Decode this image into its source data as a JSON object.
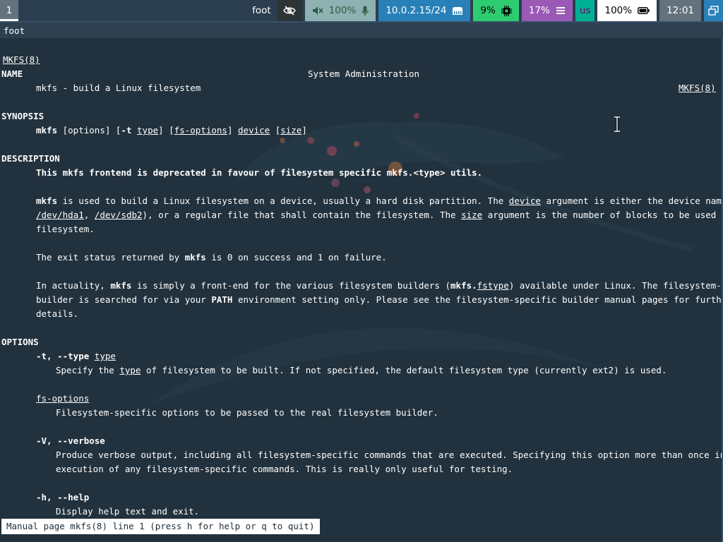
{
  "topbar": {
    "workspace": "1",
    "window_title": "foot",
    "idle_icon": "eye-slash-icon",
    "audio": {
      "volume": "100%",
      "muted_icon": "speaker-muted-icon",
      "mic_icon": "microphone-icon"
    },
    "network": {
      "address": "10.0.2.15/24",
      "icon": "ethernet-icon"
    },
    "cpu": {
      "value": "9%",
      "icon": "cpu-chip-icon"
    },
    "memory": {
      "value": "17%",
      "icon": "memory-icon"
    },
    "language": "us",
    "battery": {
      "value": "100%",
      "icon": "battery-full-icon"
    },
    "clock": "12:01",
    "tray_icon": "window-switcher-icon"
  },
  "window": {
    "title": "foot"
  },
  "man": {
    "header_left": "MKFS(8)",
    "header_center": "System Administration",
    "header_right": "MKFS(8)",
    "name_heading": "NAME",
    "name_text": "mkfs - build a Linux filesystem",
    "synopsis_heading": "SYNOPSIS",
    "synopsis": {
      "cmd": "mkfs",
      "a": " [options] [",
      "t_opt": "-t",
      "b": " ",
      "type": "type",
      "c": "] [",
      "fsopts": "fs-options",
      "d": "] ",
      "device": "device",
      "e": " [",
      "size": "size",
      "f": "]"
    },
    "description_heading": "DESCRIPTION",
    "desc_deprecated": "This mkfs frontend is deprecated in favour of filesystem specific mkfs.<type> utils.",
    "desc_p1_l1": {
      "cmd": "mkfs",
      "a": " is used to build a Linux filesystem on a device, usually a hard disk partition. The ",
      "device": "device",
      "b": " argument is either the device name (e.g.,"
    },
    "desc_p1_l2": {
      "dev1": "/dev/hda1",
      "a": ", ",
      "dev2": "/dev/sdb2",
      "b": "), or a regular file that shall contain the filesystem. The ",
      "size": "size",
      "c": " argument is the number of blocks to be used for the"
    },
    "desc_p1_l3": "filesystem.",
    "desc_p2": {
      "a": "The exit status returned by ",
      "cmd": "mkfs",
      "b": " is 0 on success and 1 on failure."
    },
    "desc_p3_l1": {
      "a": "In actuality, ",
      "cmd": "mkfs",
      "b": " is simply a front-end for the various filesystem builders (",
      "cmd2": "mkfs.",
      "fstype": "fstype",
      "c": ") available under Linux. The filesystem-specific"
    },
    "desc_p3_l2": {
      "a": "builder is searched for via your ",
      "path": "PATH",
      "b": " environment setting only. Please see the filesystem-specific builder manual pages for further"
    },
    "desc_p3_l3": "details.",
    "options_heading": "OPTIONS",
    "opt_type": {
      "flag": "-t, --type",
      "sp": " ",
      "arg": "type"
    },
    "opt_type_desc": {
      "a": "Specify the ",
      "type": "type",
      "b": " of filesystem to be built. If not specified, the default filesystem type (currently ext2) is used."
    },
    "opt_fsopts": "fs-options",
    "opt_fsopts_desc": "Filesystem-specific options to be passed to the real filesystem builder.",
    "opt_verbose": "-V, --verbose",
    "opt_verbose_desc_l1": "Produce verbose output, including all filesystem-specific commands that are executed. Specifying this option more than once inhibits",
    "opt_verbose_desc_l2": "execution of any filesystem-specific commands. This is really only useful for testing.",
    "opt_help": "-h, --help",
    "opt_help_desc": "Display help text and exit."
  },
  "status_line": "Manual page mkfs(8) line 1 (press h for help or q to quit)"
}
